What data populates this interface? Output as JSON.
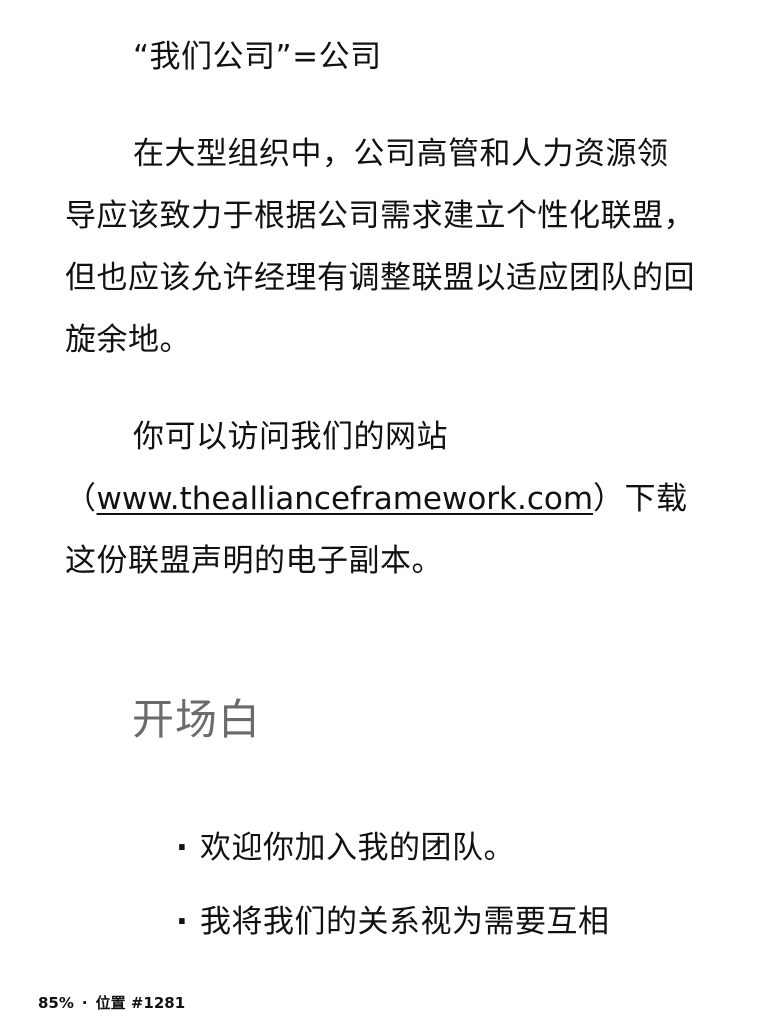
{
  "content": {
    "para1": "“我们公司”=公司",
    "para2": "在大型组织中，公司高管和人力资源领导应该致力于根据公司需求建立个性化联盟，但也应该允许经理有调整联盟以适应团队的回旋余地。",
    "para3_before": "你可以访问我们的网站（",
    "para3_link": "www.theallianceframework.com",
    "para3_after": "）下载这份联盟声明的电子副本。",
    "section_heading": "开场白",
    "bullets": [
      {
        "marker": "·",
        "text": "欢迎你加入我的团队。"
      },
      {
        "marker": "·",
        "text": "我将我们的关系视为需要互相"
      }
    ]
  },
  "status": {
    "progress": "85%",
    "separator": "·",
    "location": "位置 #1281"
  }
}
